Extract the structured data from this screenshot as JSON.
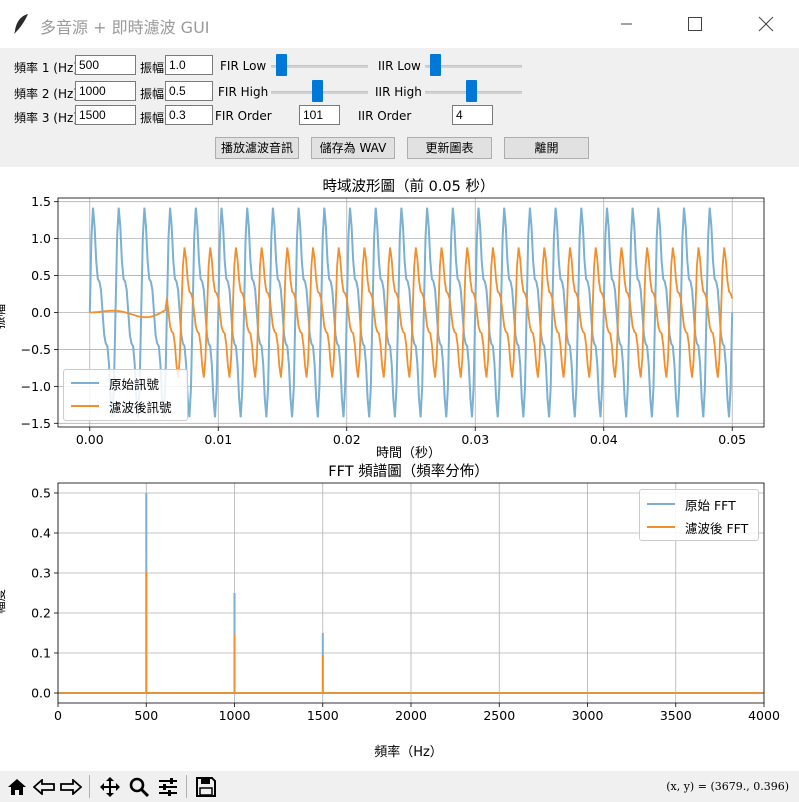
{
  "window": {
    "title": "多音源 + 即時濾波 GUI"
  },
  "controls": {
    "rows": [
      {
        "freq_label": "頻率 1 (Hz)",
        "freq_value": "500",
        "amp_label": "振幅",
        "amp_value": "1.0"
      },
      {
        "freq_label": "頻率 2 (Hz)",
        "freq_value": "1000",
        "amp_label": "振幅",
        "amp_value": "0.5"
      },
      {
        "freq_label": "頻率 3 (Hz)",
        "freq_value": "1500",
        "amp_label": "振幅",
        "amp_value": "0.3"
      }
    ],
    "fir_low_label": "FIR Low",
    "fir_high_label": "FIR High",
    "fir_order_label": "FIR Order",
    "fir_order_value": "101",
    "iir_low_label": "IIR Low",
    "iir_high_label": "IIR High",
    "iir_order_label": "IIR Order",
    "iir_order_value": "4",
    "buttons": {
      "play": "播放濾波音訊",
      "save": "儲存為 WAV",
      "refresh": "更新圖表",
      "quit": "離開"
    }
  },
  "chart_data": [
    {
      "type": "line",
      "title": "時域波形圖（前 0.05 秒）",
      "xlabel": "時間（秒）",
      "ylabel": "振幅",
      "xlim": [
        0,
        0.05
      ],
      "ylim": [
        -1.5,
        1.5
      ],
      "xticks": [
        "0.00",
        "0.01",
        "0.02",
        "0.03",
        "0.04",
        "0.05"
      ],
      "yticks": [
        "1.5",
        "1.0",
        "0.5",
        "0.0",
        "−0.5",
        "−1.0",
        "−1.5"
      ],
      "legend_position": "lower-left",
      "grid": true,
      "series": [
        {
          "name": "原始訊號",
          "color": "#7ab0d2",
          "description_values": {
            "f1_hz": 500,
            "a1": 1.0,
            "f2_hz": 1000,
            "a2": 0.5,
            "f3_hz": 1500,
            "a3": 0.3
          },
          "peak": 1.42,
          "trough": -1.42
        },
        {
          "name": "濾波後訊號",
          "color": "#f28e2b",
          "peak": 0.9,
          "trough": -0.9,
          "settle_start_s": 0.006
        }
      ]
    },
    {
      "type": "line",
      "title": "FFT 頻譜圖（頻率分佈）",
      "xlabel": "頻率（Hz）",
      "ylabel": "幅度",
      "xlim": [
        0,
        4000
      ],
      "ylim": [
        0,
        0.5
      ],
      "xticks": [
        "0",
        "500",
        "1000",
        "1500",
        "2000",
        "2500",
        "3000",
        "3500",
        "4000"
      ],
      "yticks": [
        "0.5",
        "0.4",
        "0.3",
        "0.2",
        "0.1",
        "0.0"
      ],
      "legend_position": "upper-right",
      "grid": true,
      "series": [
        {
          "name": "原始 FFT",
          "color": "#7ab0d2",
          "x": [
            500,
            1000,
            1500
          ],
          "values": [
            0.5,
            0.25,
            0.15
          ]
        },
        {
          "name": "濾波後 FFT",
          "color": "#f28e2b",
          "x": [
            500,
            1000,
            1500
          ],
          "values": [
            0.305,
            0.15,
            0.095
          ]
        }
      ]
    }
  ],
  "status": {
    "coords": "(x, y) = (3679., 0.396)"
  },
  "toolbar": {
    "icons": [
      "home-icon",
      "back-icon",
      "forward-icon",
      "pan-icon",
      "zoom-icon",
      "configure-icon",
      "save-icon"
    ]
  }
}
